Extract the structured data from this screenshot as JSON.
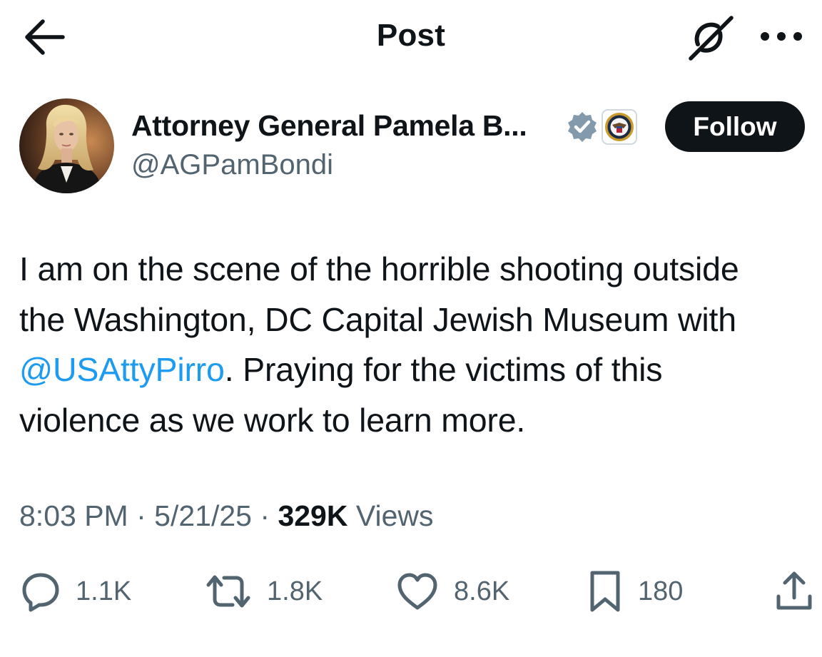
{
  "header": {
    "title": "Post"
  },
  "author": {
    "display_name": "Attorney General Pamela B...",
    "handle": "@AGPamBondi",
    "verified_badge_color": "#829aab",
    "follow_label": "Follow"
  },
  "post": {
    "lines": [
      "I am on the scene of the horrible shooting outside",
      "the Washington, DC Capital Jewish Museum with"
    ],
    "mention": "@USAttyPirro",
    "line3_rest": ". Praying for the victims of this",
    "line4": "violence as we work to learn more."
  },
  "meta": {
    "time": "8:03 PM",
    "separator": "·",
    "date": "5/21/25",
    "views_count": "329K",
    "views_label": "Views"
  },
  "actions": {
    "replies": "1.1K",
    "reposts": "1.8K",
    "likes": "8.6K",
    "bookmarks": "180"
  },
  "icons": {
    "back": "arrow-left-icon",
    "grok": "grok-icon",
    "more": "more-horizontal-icon",
    "verified": "verified-badge-icon",
    "affiliate": "doj-seal-icon",
    "reply": "reply-icon",
    "repost": "repost-icon",
    "like": "heart-icon",
    "bookmark": "bookmark-icon",
    "share": "share-icon"
  },
  "colors": {
    "text_primary": "#0f1419",
    "text_secondary": "#536471",
    "link": "#1d9bf0",
    "follow_bg": "#0f1419"
  }
}
